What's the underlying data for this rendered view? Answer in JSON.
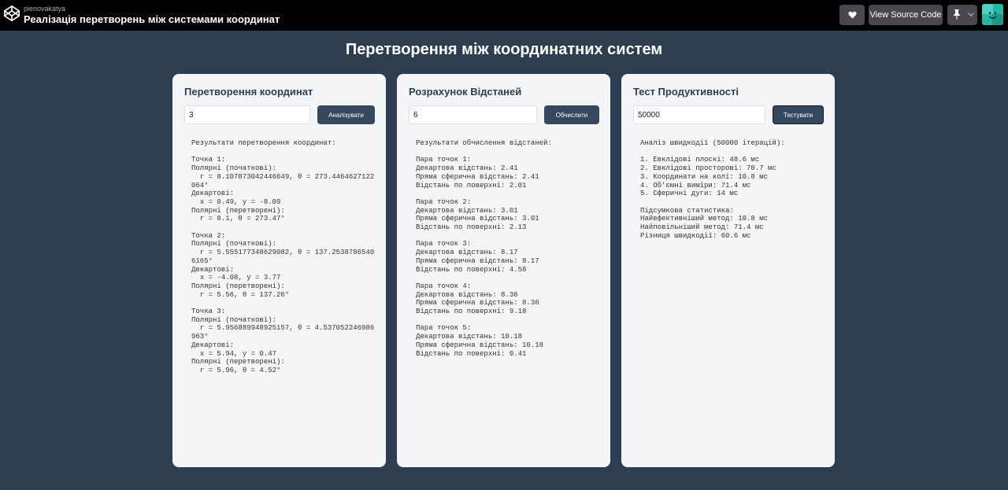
{
  "header": {
    "author": "pienovakatya",
    "pen_title": "Реалізація перетворень між системами координат",
    "view_source_label": "View Source Code"
  },
  "page": {
    "title": "Перетворення між координатних систем"
  },
  "cards": [
    {
      "title": "Перетворення координат",
      "input_value": "3",
      "button_label": "Аналізувати",
      "result": "Результати перетворення координат:\n\nТочка 1:\nПолярні (початкові):\n  r = 8.107873042446649, θ = 273.4464627122064°\nДекартові:\n  x = 0.49, y = -8.09\nПолярні (перетворені):\n  r = 8.1, θ = 273.47°\n\nТочка 2:\nПолярні (початкові):\n  r = 5.555177348629082, θ = 137.25387865406165°\nДекартові:\n  x = -4.08, y = 3.77\nПолярні (перетворені):\n  r = 5.56, θ = 137.26°\n\nТочка 3:\nПолярні (початкові):\n  r = 5.956889948925157, θ = 4.537052246986963°\nДекартові:\n  x = 5.94, y = 0.47\nПолярні (перетворені):\n  r = 5.96, θ = 4.52°"
    },
    {
      "title": "Розрахунок Відстаней",
      "input_value": "6",
      "button_label": "Обчислити",
      "result": "Результати обчислення відстаней:\n\nПара точок 1:\nДекартова відстань: 2.41\nПряма сферична відстань: 2.41\nВідстань по поверхні: 2.01\n\nПара точок 2:\nДекартова відстань: 3.01\nПряма сферична відстань: 3.01\nВідстань по поверхні: 2.13\n\nПара точок 3:\nДекартова відстань: 8.17\nПряма сферична відстань: 8.17\nВідстань по поверхні: 4.58\n\nПара точок 4:\nДекартова відстань: 8.36\nПряма сферична відстань: 8.36\nВідстань по поверхні: 9.18\n\nПара точок 5:\nДекартова відстань: 10.18\nПряма сферична відстань: 10.18\nВідстань по поверхні: 0.41"
    },
    {
      "title": "Тест Продуктивності",
      "input_value": "50000",
      "button_label": "Тестувати",
      "result": "Аналіз швидкодії (50000 ітерацій):\n\n1. Евклідові плоскі: 48.6 мс\n2. Евклідові просторові: 70.7 мс\n3. Координати на колі: 10.8 мс\n4. Об'ємні виміри: 71.4 мс\n5. Сферичні дуги: 14 мс\n\nПідсумкова статистика:\nНайефективніший метод: 10.8 мс\nНайповільніший метод: 71.4 мс\nРізниця швидкодії: 60.6 мс"
    }
  ],
  "colors": {
    "page_background": "#2c3e50",
    "card_background": "#f4f5f7",
    "button_background": "#34495e",
    "topbar_background": "#000000"
  },
  "icons": {
    "logo": "codepen-logo-icon",
    "heart": "heart-icon",
    "pin": "pin-icon",
    "chevron": "chevron-down-icon",
    "avatar": "user-avatar-icon"
  }
}
